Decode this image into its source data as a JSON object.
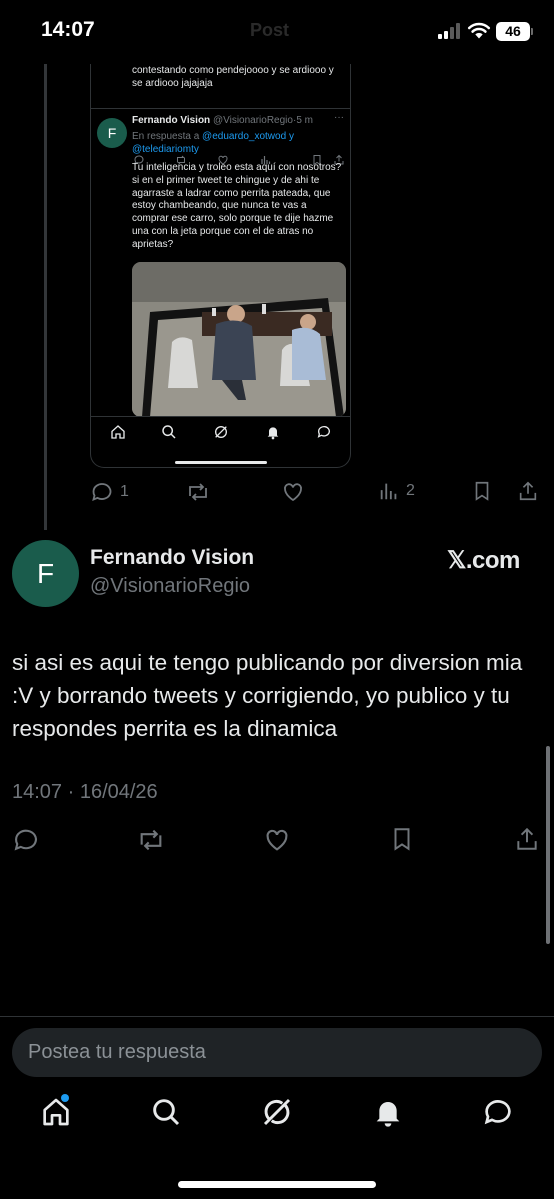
{
  "status_bar": {
    "time": "14:07",
    "title": "Post",
    "battery": "46",
    "icons": [
      "cellular-signal-icon",
      "wifi-icon",
      "battery-icon"
    ]
  },
  "embedded_screenshot": {
    "top_tweet_text": "contestando como pendejoooo y se ardiooo y se ardiooo jajajaja",
    "author_initial": "F",
    "author_name": "Fernando Vision",
    "author_handle": "@VisionarioRegio",
    "time": "5 m",
    "reply_prefix": "En respuesta a",
    "reply_mention_1": "@eduardo_xotwod",
    "reply_connector": "y",
    "reply_mention_2": "@telediariomty",
    "text": "Tu inteligencia y troleo esta aquí con nosotros? si en el primer tweet te chingue y de ahi te agarraste a ladrar como perrita pateada, que estoy chambeando, que nunca te vas a comprar ese carro, solo porque te dije hazme una con la jeta porque con el de atras no aprietas?",
    "fab_label": "+",
    "nav_icons": [
      "home-icon",
      "search-icon",
      "grok-icon",
      "notifications-icon",
      "messages-icon"
    ]
  },
  "parent_actions": {
    "replies": "1",
    "views": "2"
  },
  "tweet": {
    "author_initial": "F",
    "author_name": "Fernando Vision",
    "author_handle": "@VisionarioRegio",
    "brand": "𝕏.com",
    "text": "si asi es aqui te tengo publicando por diversion mia :V  y borrando tweets y corrigiendo, yo publico y tu respondes perrita es la dinamica",
    "timestamp": "14:07 · 16/04/26"
  },
  "reply": {
    "placeholder": "Postea tu respuesta"
  },
  "colors": {
    "background": "#000000",
    "text_primary": "#e7e9ea",
    "text_secondary": "#71767b",
    "accent": "#1d9bf0",
    "avatar": "#1a5c4c"
  }
}
